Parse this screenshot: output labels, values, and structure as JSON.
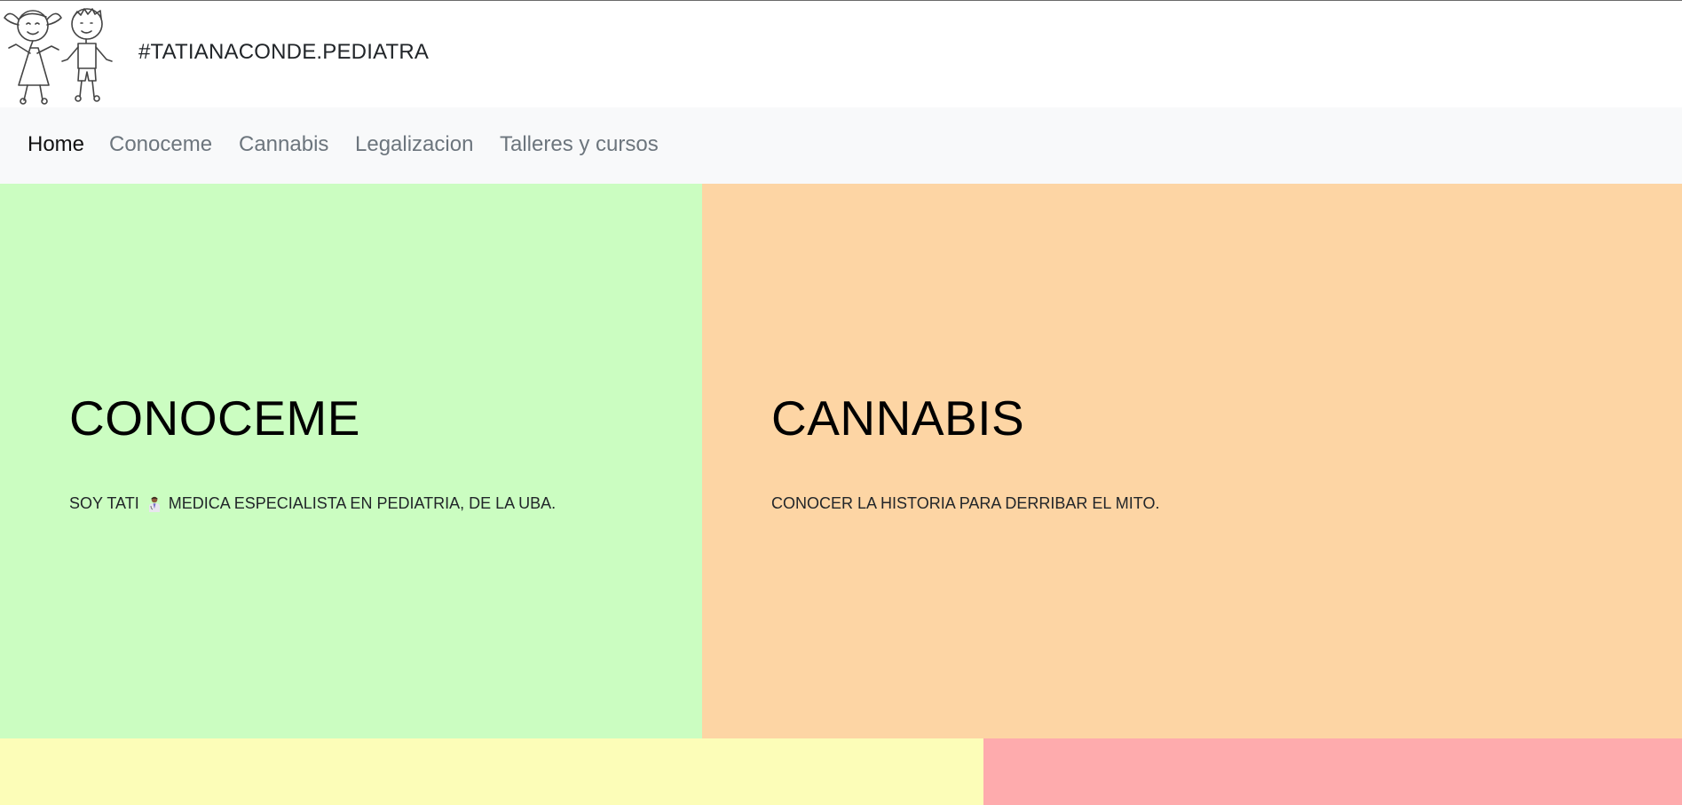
{
  "header": {
    "brand": "#TATIANACONDE.PEDIATRA",
    "logo_icon": "kids-drawing-icon"
  },
  "nav": {
    "items": [
      {
        "label": "Home",
        "active": true
      },
      {
        "label": "Conoceme",
        "active": false
      },
      {
        "label": "Cannabis",
        "active": false
      },
      {
        "label": "Legalizacion",
        "active": false
      },
      {
        "label": "Talleres y cursos",
        "active": false
      }
    ],
    "active_color": "#111111",
    "inactive_color": "#6c757d"
  },
  "sections": {
    "conoceme": {
      "title": "CONOCEME",
      "text_before": "SOY TATI",
      "icon": "doctor-emoji-icon",
      "text_after": "MEDICA ESPECIALISTA EN PEDIATRIA, DE LA UBA.",
      "color": "#cbfdc1"
    },
    "cannabis": {
      "title": "CANNABIS",
      "text": "CONOCER LA HISTORIA PARA DERRIBAR EL MITO.",
      "color": "#fdd5a4"
    },
    "bottom_left": {
      "color": "#fcfdb8"
    },
    "bottom_right": {
      "color": "#feabad"
    }
  }
}
